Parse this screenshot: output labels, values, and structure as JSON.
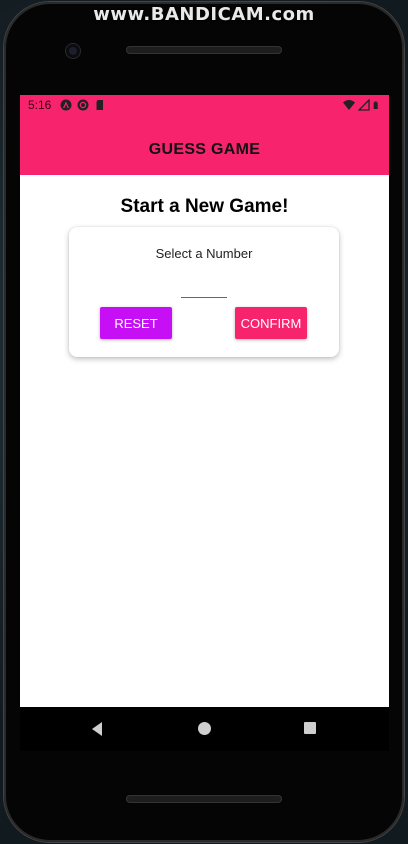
{
  "watermark": "www.BANDICAM.com",
  "status_bar": {
    "time": "5:16",
    "left_icons": [
      "android-auto-icon",
      "sync-icon",
      "sd-card-icon"
    ],
    "right_icons": [
      "wifi-icon",
      "signal-icon",
      "battery-icon"
    ]
  },
  "app_bar": {
    "title": "GUESS GAME",
    "color": "#f7246d"
  },
  "main": {
    "title": "Start a New Game!",
    "card": {
      "label": "Select a Number",
      "input_value": "",
      "reset_label": "RESET",
      "confirm_label": "CONFIRM",
      "reset_color": "#c70ff5",
      "confirm_color": "#f7246d"
    }
  },
  "nav_bar": {
    "icons": [
      "back-icon",
      "home-icon",
      "recents-icon"
    ]
  }
}
